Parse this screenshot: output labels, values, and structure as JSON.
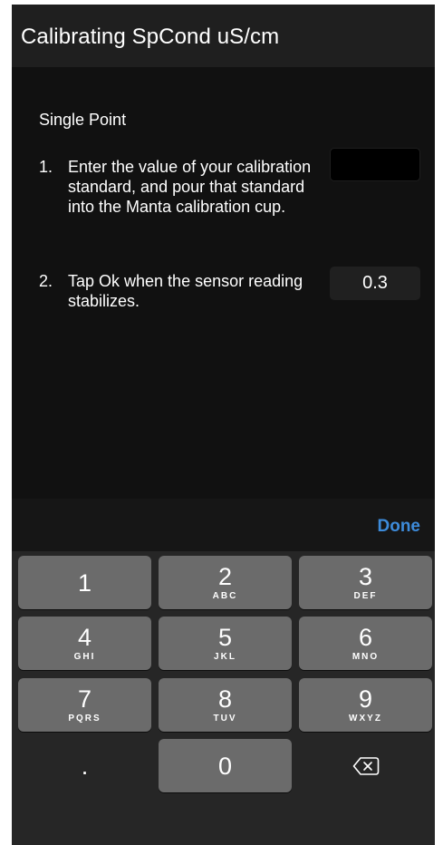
{
  "header": {
    "title": "Calibrating SpCond uS/cm"
  },
  "content": {
    "section_title": "Single Point",
    "steps": [
      {
        "num": "1.",
        "text": "Enter the value of your calibration standard, and pour that standard into the Manta calibration cup."
      },
      {
        "num": "2.",
        "text": "Tap Ok when the sensor reading stabilizes."
      }
    ],
    "standard_input_value": "",
    "sensor_reading": "0.3"
  },
  "keyboard": {
    "done_label": "Done",
    "keys": [
      {
        "digit": "1",
        "letters": ""
      },
      {
        "digit": "2",
        "letters": "ABC"
      },
      {
        "digit": "3",
        "letters": "DEF"
      },
      {
        "digit": "4",
        "letters": "GHI"
      },
      {
        "digit": "5",
        "letters": "JKL"
      },
      {
        "digit": "6",
        "letters": "MNO"
      },
      {
        "digit": "7",
        "letters": "PQRS"
      },
      {
        "digit": "8",
        "letters": "TUV"
      },
      {
        "digit": "9",
        "letters": "WXYZ"
      },
      {
        "digit": ".",
        "letters": ""
      },
      {
        "digit": "0",
        "letters": ""
      }
    ],
    "backspace_icon": "backspace-icon"
  },
  "colors": {
    "accent": "#3d8bda",
    "background": "#111111",
    "key": "#6b6b6b"
  }
}
